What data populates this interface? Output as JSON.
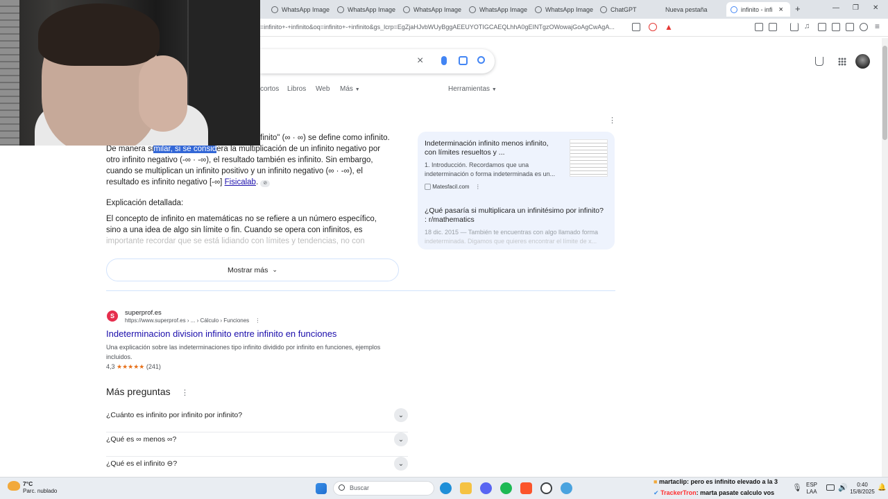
{
  "browser": {
    "tabs": [
      {
        "label": "WhatsApp Image"
      },
      {
        "label": "WhatsApp Image"
      },
      {
        "label": "WhatsApp Image"
      },
      {
        "label": "WhatsApp Image"
      },
      {
        "label": "WhatsApp Image"
      },
      {
        "label": "ChatGPT"
      },
      {
        "label": "Nueva pestaña"
      },
      {
        "label": "infinito - infi"
      }
    ],
    "url": "=infinito+-+infinito&oq=infinito+-+infinito&gs_lcrp=EgZjaHJvbWUyBggAEEUYOTIGCAEQLhhA0gEINTgzOWowajGoAgCwAgA..."
  },
  "google": {
    "nav_items": [
      "cortos",
      "Libros",
      "Web",
      "Más"
    ],
    "tools_label": "Herramientas",
    "ai_overview": {
      "line1_fragment": "finito\" (∞ · ∞) se define como infinito.",
      "line2_pre": "De manera si",
      "line2_highlight": "milar, si se consid",
      "line2_post": "era la multiplicación de un infinito negativo por",
      "line3": "otro infinito negativo (-∞ · -∞), el resultado también es infinito. Sin embargo,",
      "line4": "cuando se multiplican un infinito positivo y un infinito negativo (∞ · -∞), el",
      "line5_pre": "resultado es infinito negativo [-∞]",
      "line5_link": "Fisicalab",
      "detail_heading": "Explicación detallada:",
      "detail_line1": "El concepto de infinito en matemáticas no se refiere a un número específico,",
      "detail_line2": "sino a una idea de algo sin límite o fin. Cuando se opera con infinitos, es",
      "detail_line3": "importante recordar que se está lidiando con límites y tendencias, no con",
      "show_more": "Mostrar más"
    },
    "side_cards": [
      {
        "title_line1": "Indeterminación infinito menos infinito,",
        "title_line2": "con límites resueltos y ...",
        "snippet_line1": "1. Introducción. Recordamos que una",
        "snippet_line2": "indeterminación o forma indeterminada es un...",
        "source": "Matesfacil.com"
      },
      {
        "title_line1": "¿Qué pasaría si multiplicara un infinitésimo por infinito?",
        "title_line2": ": r/mathematics",
        "snippet_line1": "18 dic. 2015 — También te encuentras con algo llamado forma",
        "snippet_line2": "indeterminada. Digamos que quieres encontrar el límite de x..."
      }
    ],
    "result": {
      "site": "superprof.es",
      "breadcrumb": "https://www.superprof.es › ... › Cálculo › Funciones",
      "title": "Indeterminacion division infinito entre infinito en funciones",
      "snippet_line1": "Una explicación sobre las indeterminaciones tipo infinito dividido por infinito en funciones, ejemplos",
      "snippet_line2": "incluidos.",
      "rating": "4,3",
      "stars": "★★★★★",
      "reviews": "(241)"
    },
    "more_questions": {
      "heading": "Más preguntas",
      "items": [
        "¿Cuánto es infinito por infinito por infinito?",
        "¿Qué es ∞ menos ∞?",
        "¿Qué es el infinito ⊖?"
      ]
    }
  },
  "taskbar": {
    "weather_temp": "7°C",
    "weather_desc": "Parc. nublado",
    "search_placeholder": "Buscar",
    "chat": [
      {
        "user": "martaclip",
        "message": ": pero es infinito elevado a la 3"
      },
      {
        "user": "TrackerTron",
        "message": ": marta pasate calculo vos"
      }
    ],
    "lang1": "ESP",
    "lang2": "LAA",
    "time": "0:40",
    "date": "15/8/2025"
  }
}
